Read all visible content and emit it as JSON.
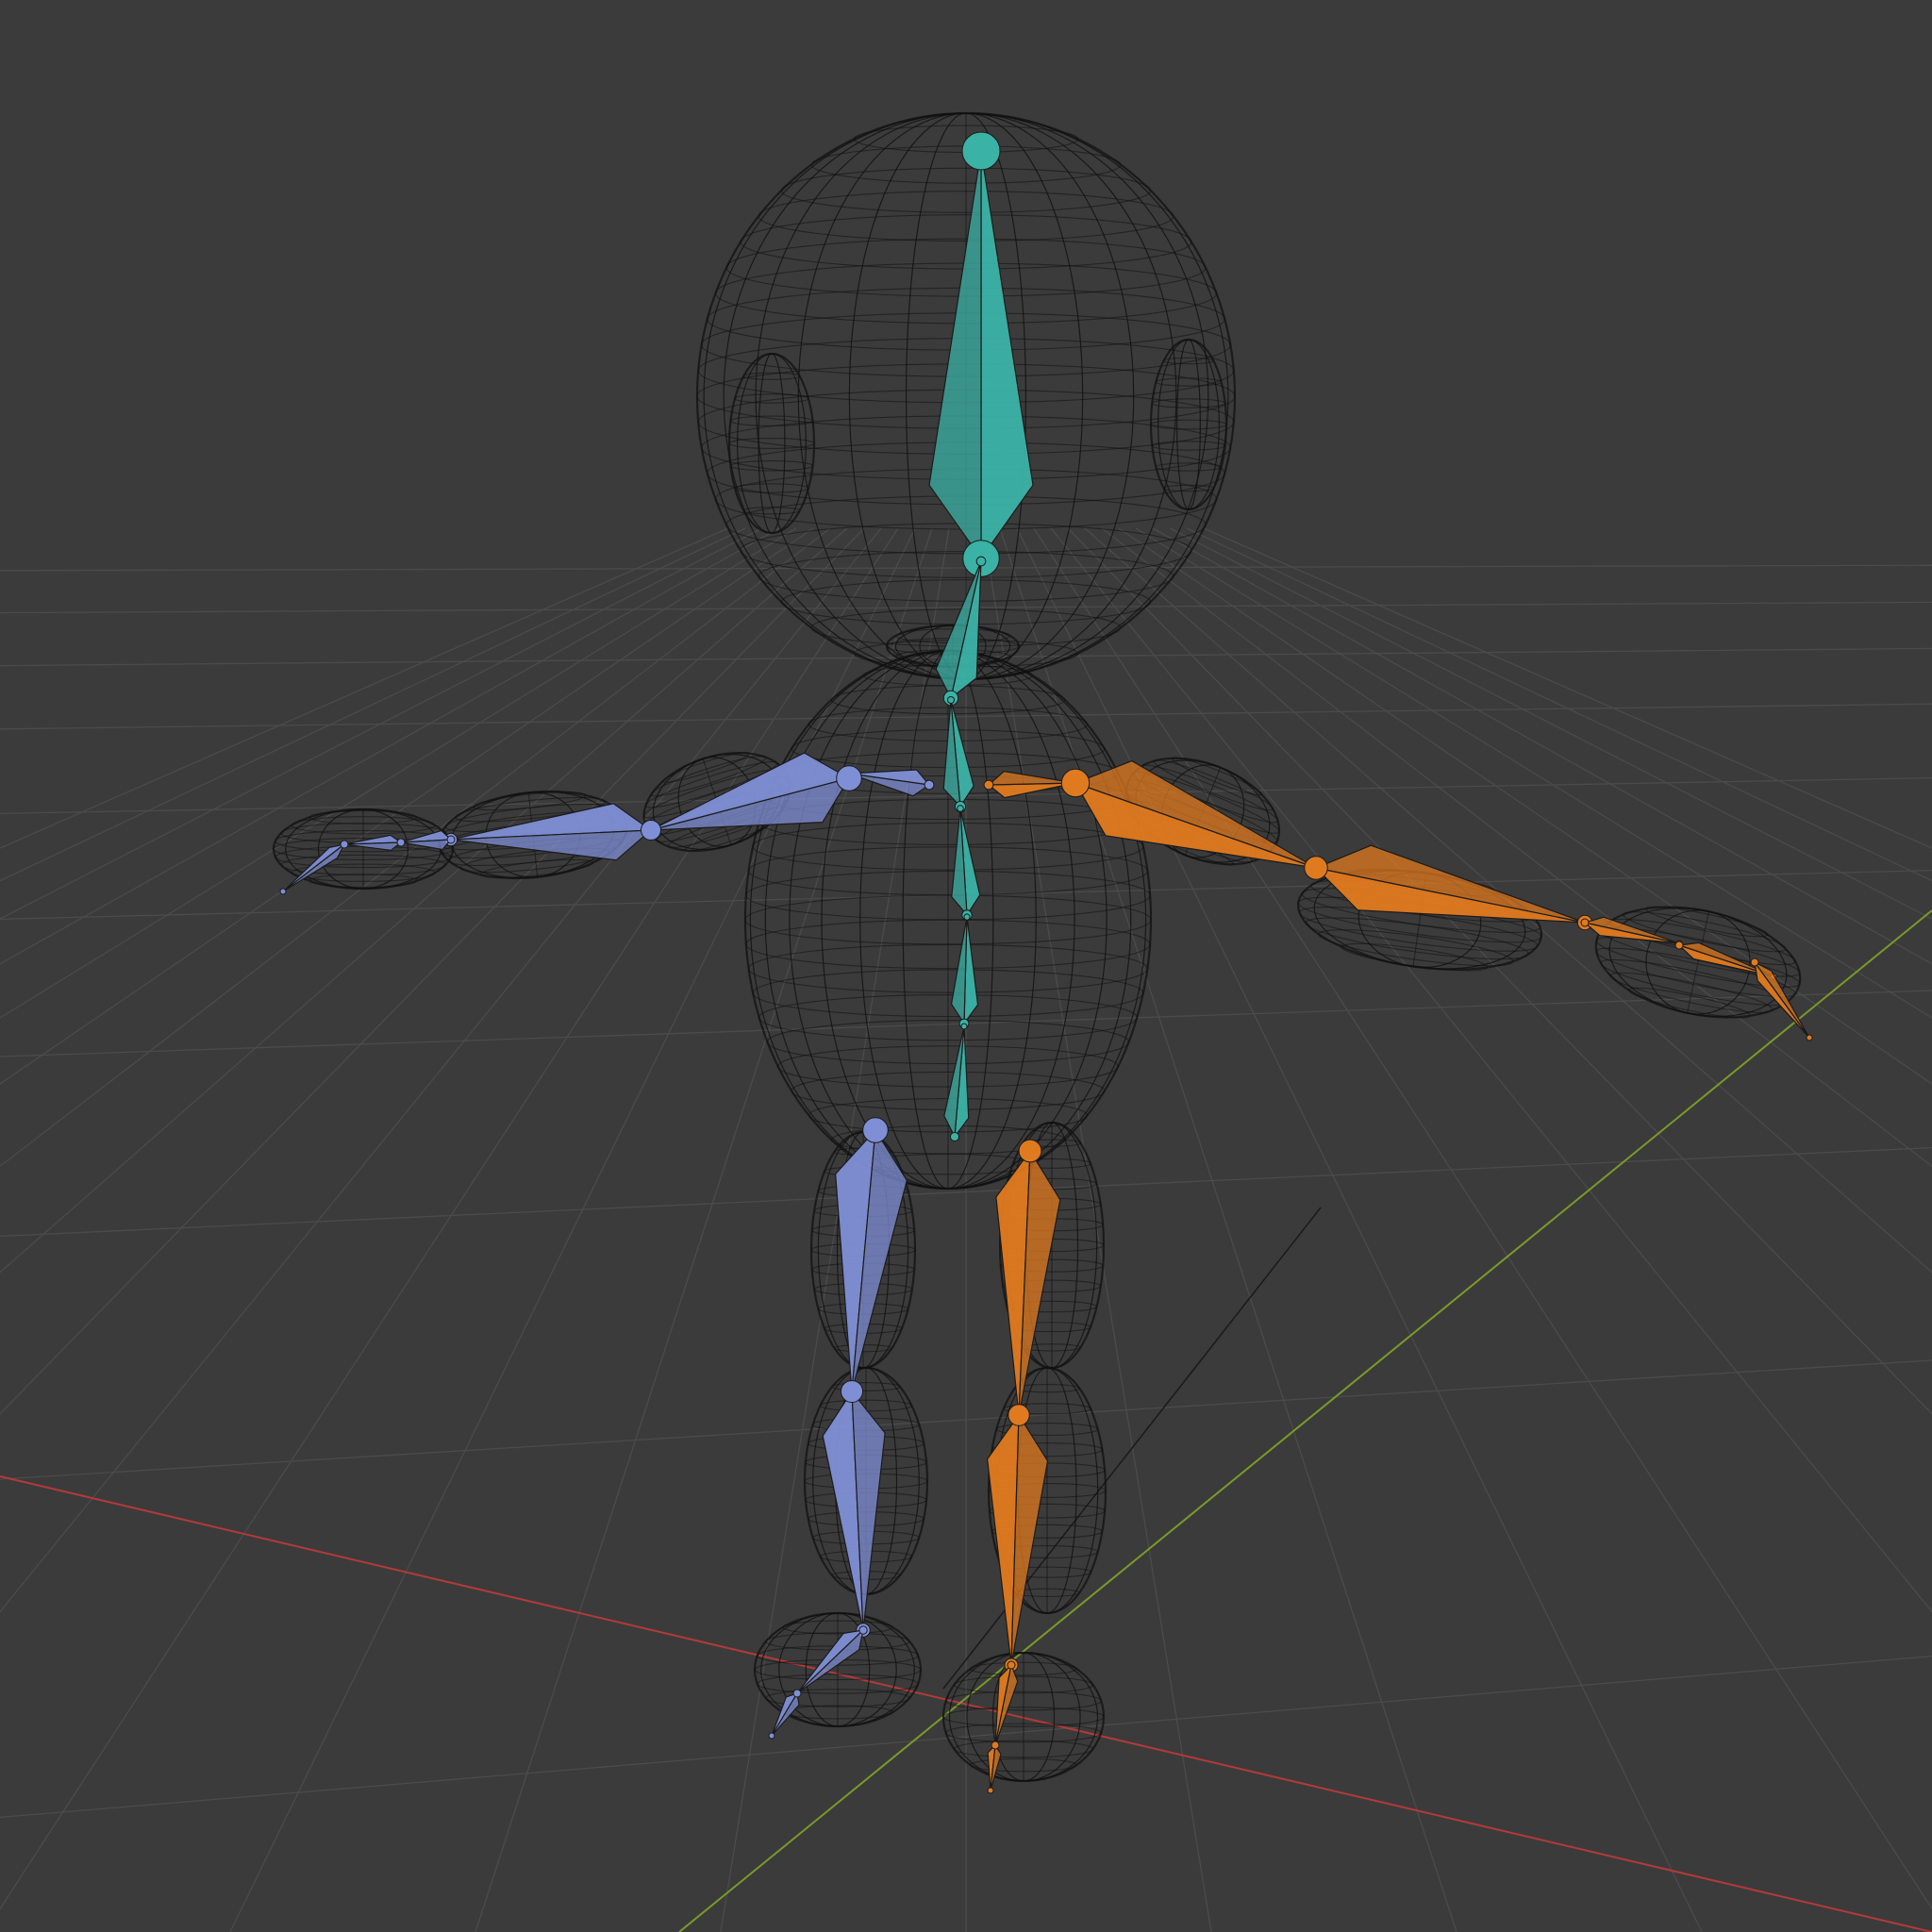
{
  "viewport": {
    "mode": "wireframe",
    "background_color": "#3b3b3b",
    "grid_color": "#4b4b4b",
    "axes": {
      "x_axis_color": "#b33a3a",
      "y_axis_color": "#7a9a2a"
    }
  },
  "model": {
    "object": "character-mesh",
    "display": "wireframe",
    "wire_color": "#111111"
  },
  "armature": {
    "display": "octahedral",
    "colors": {
      "spine": "#3bb2a6",
      "left_side": "#7f8fd6",
      "right_side": "#e07a1f"
    },
    "bone_groups": [
      "spine",
      "arm-left",
      "arm-right",
      "leg-left",
      "leg-right"
    ]
  }
}
